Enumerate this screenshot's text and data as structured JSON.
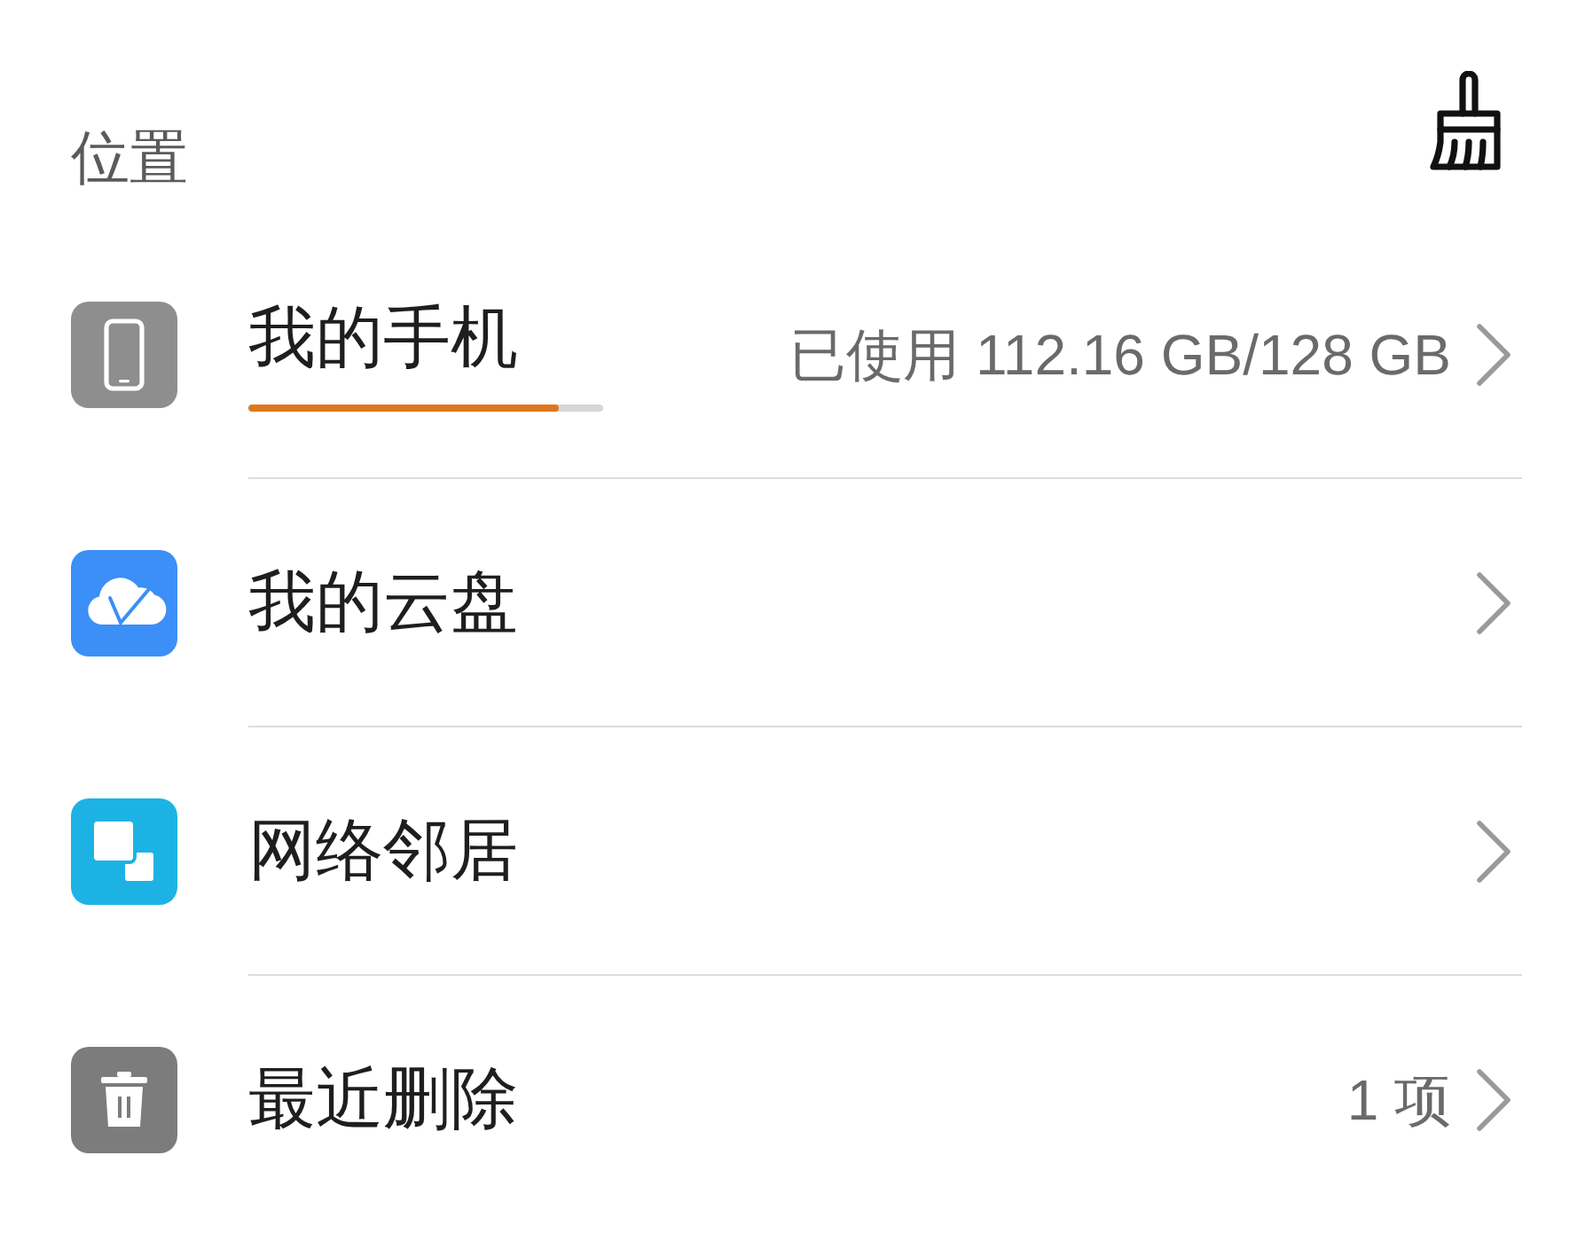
{
  "header": {
    "title": "位置"
  },
  "items": [
    {
      "kind": "storage",
      "title": "我的手机",
      "value": "已使用 112.16 GB/128 GB",
      "level": 0.876
    },
    {
      "kind": "cloud",
      "title": "我的云盘"
    },
    {
      "kind": "network",
      "title": "网络邻居"
    },
    {
      "kind": "trash",
      "title": "最近删除",
      "value": "1 项"
    }
  ]
}
